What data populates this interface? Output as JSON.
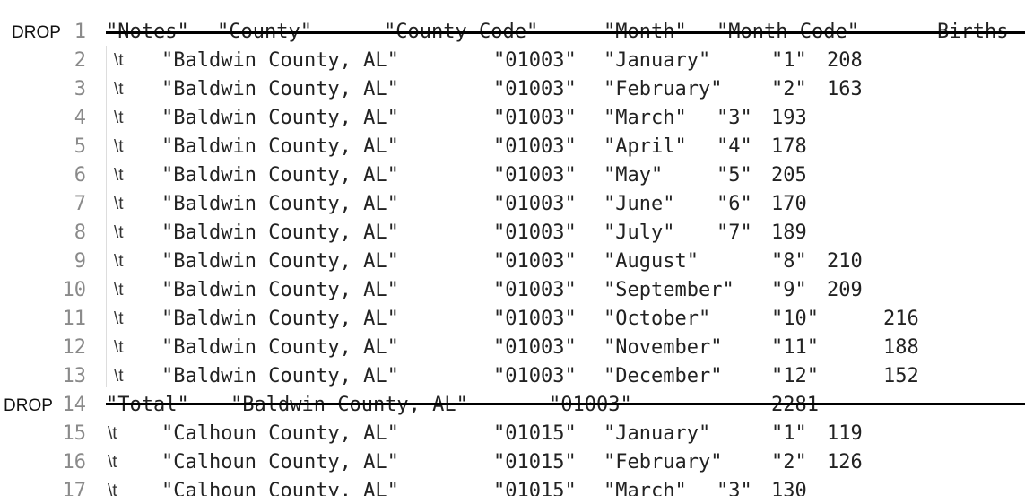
{
  "lines": [
    {
      "drop": "DROP",
      "num": "1",
      "tab": "",
      "fields": [
        "\"Notes\"",
        "\"County\"",
        "\"County Code\"",
        "\"Month\"",
        "\"Month Code\"",
        "Births"
      ],
      "struck": true
    },
    {
      "drop": "",
      "num": "2",
      "tab": "\\t",
      "fields": [
        "\"Baldwin County, AL\"",
        "\"01003\"",
        "\"January\"",
        "\"1\"",
        "208"
      ],
      "struck": false
    },
    {
      "drop": "",
      "num": "3",
      "tab": "\\t",
      "fields": [
        "\"Baldwin County, AL\"",
        "\"01003\"",
        "\"February\"",
        "\"2\"",
        "163"
      ],
      "struck": false
    },
    {
      "drop": "",
      "num": "4",
      "tab": "\\t",
      "fields": [
        "\"Baldwin County, AL\"",
        "\"01003\"",
        "\"March\"",
        "\"3\"",
        "193"
      ],
      "struck": false
    },
    {
      "drop": "",
      "num": "5",
      "tab": "\\t",
      "fields": [
        "\"Baldwin County, AL\"",
        "\"01003\"",
        "\"April\"",
        "\"4\"",
        "178"
      ],
      "struck": false
    },
    {
      "drop": "",
      "num": "6",
      "tab": "\\t",
      "fields": [
        "\"Baldwin County, AL\"",
        "\"01003\"",
        "\"May\"",
        "\"5\"",
        "205"
      ],
      "struck": false
    },
    {
      "drop": "",
      "num": "7",
      "tab": "\\t",
      "fields": [
        "\"Baldwin County, AL\"",
        "\"01003\"",
        "\"June\"",
        "\"6\"",
        "170"
      ],
      "struck": false
    },
    {
      "drop": "",
      "num": "8",
      "tab": "\\t",
      "fields": [
        "\"Baldwin County, AL\"",
        "\"01003\"",
        "\"July\"",
        "\"7\"",
        "189"
      ],
      "struck": false
    },
    {
      "drop": "",
      "num": "9",
      "tab": "\\t",
      "fields": [
        "\"Baldwin County, AL\"",
        "\"01003\"",
        "\"August\"",
        "\"8\"",
        "210"
      ],
      "struck": false
    },
    {
      "drop": "",
      "num": "10",
      "tab": "\\t",
      "fields": [
        "\"Baldwin County, AL\"",
        "\"01003\"",
        "\"September\"",
        "\"9\"",
        "209"
      ],
      "struck": false
    },
    {
      "drop": "",
      "num": "11",
      "tab": "\\t",
      "fields": [
        "\"Baldwin County, AL\"",
        "\"01003\"",
        "\"October\"",
        "\"10\"",
        "216"
      ],
      "struck": false
    },
    {
      "drop": "",
      "num": "12",
      "tab": "\\t",
      "fields": [
        "\"Baldwin County, AL\"",
        "\"01003\"",
        "\"November\"",
        "\"11\"",
        "188"
      ],
      "struck": false
    },
    {
      "drop": "",
      "num": "13",
      "tab": "\\t",
      "fields": [
        "\"Baldwin County, AL\"",
        "\"01003\"",
        "\"December\"",
        "\"12\"",
        "152"
      ],
      "struck": false
    },
    {
      "drop": "DROP",
      "num": "14",
      "tab": "",
      "fields": [
        "\"Total\"",
        "\"Baldwin County, AL\"",
        "\"01003\"",
        "",
        "",
        "2281"
      ],
      "struck": true
    },
    {
      "drop": "",
      "num": "15",
      "tab": "\\t",
      "fields": [
        "\"Calhoun County, AL\"",
        "\"01015\"",
        "\"January\"",
        "\"1\"",
        "119"
      ],
      "struck": false
    },
    {
      "drop": "",
      "num": "16",
      "tab": "\\t",
      "fields": [
        "\"Calhoun County, AL\"",
        "\"01015\"",
        "\"February\"",
        "\"2\"",
        "126"
      ],
      "struck": false
    },
    {
      "drop": "",
      "num": "17",
      "tab": "\\t",
      "fields": [
        "\"Calhoun County, AL\"",
        "\"01015\"",
        "\"March\"",
        "\"3\"",
        "130"
      ],
      "struck": false
    }
  ]
}
